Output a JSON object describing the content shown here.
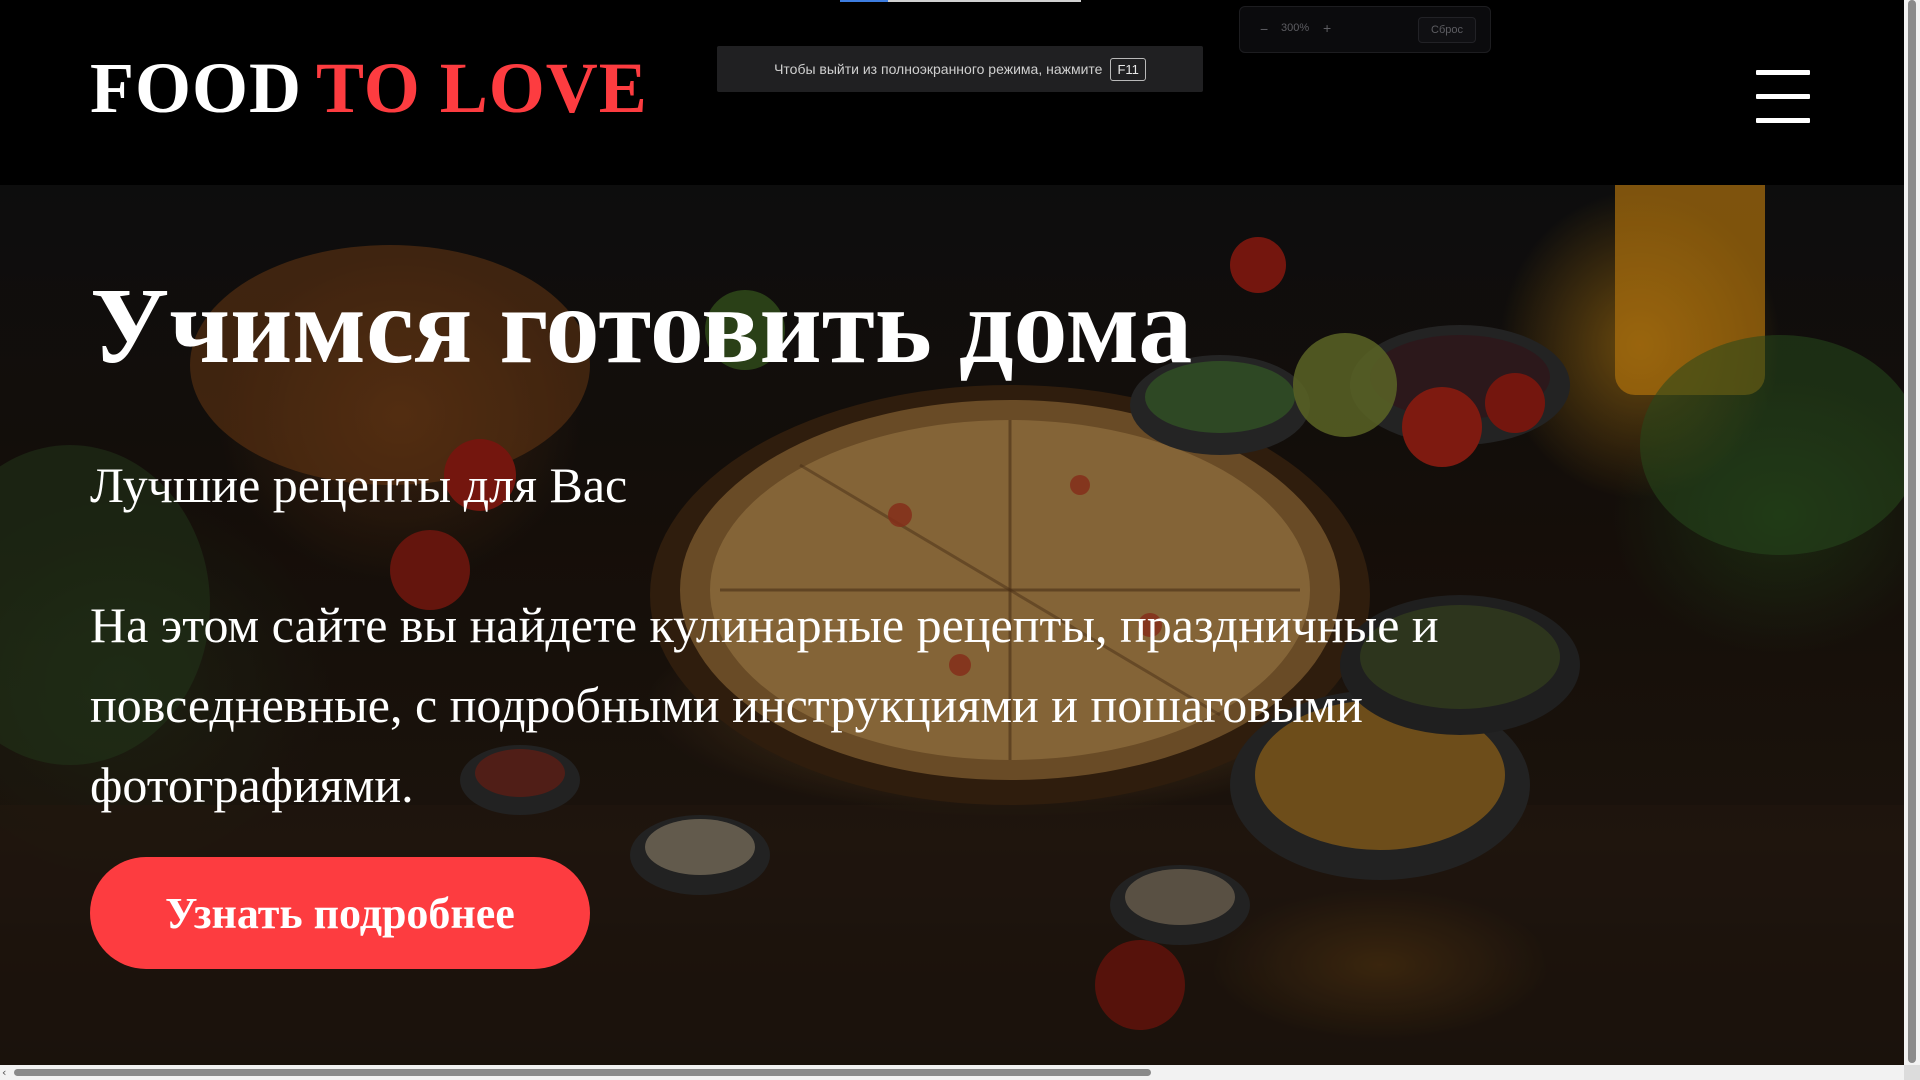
{
  "brand": {
    "part1": "FOOD",
    "part2": "TO LOVE",
    "accent_color": "#fd3c40"
  },
  "menu": {
    "icon": "hamburger-menu-icon"
  },
  "fullscreen_notice": {
    "text": "Чтобы выйти из полноэкранного режима, нажмите",
    "key": "F11"
  },
  "zoom": {
    "minus": "−",
    "value": "300%",
    "plus": "+",
    "reset": "Сброс"
  },
  "hero": {
    "title": "Учимся готовить дома",
    "subtitle": "Лучшие рецепты для Вас",
    "text": "На этом сайте вы найдете кулинарные рецепты, праздничные и повседневные, с подробными инструкциями и пошаговыми фотографиями.",
    "button": "Узнать подробнее",
    "button_color": "#fd3c40",
    "background_image": "food-table-photo"
  },
  "scrollbar": {
    "left_arrow": "‹"
  }
}
